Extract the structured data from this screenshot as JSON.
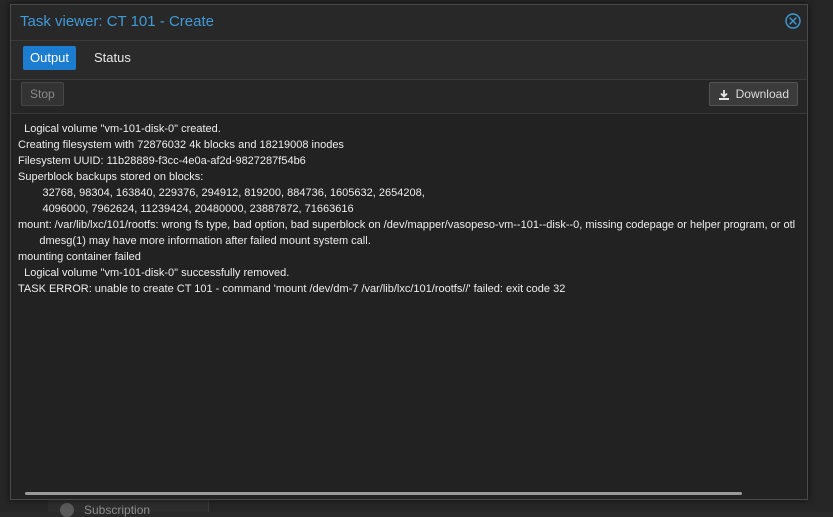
{
  "window": {
    "title": "Task viewer: CT 101 - Create",
    "close_icon": "close-circle-icon"
  },
  "tabs": [
    {
      "label": "Output",
      "active": true
    },
    {
      "label": "Status",
      "active": false
    }
  ],
  "toolbar": {
    "stop_label": "Stop",
    "download_label": "Download",
    "download_icon": "download-icon"
  },
  "log_lines": [
    "  Logical volume \"vm-101-disk-0\" created.",
    "Creating filesystem with 72876032 4k blocks and 18219008 inodes",
    "Filesystem UUID: 11b28889-f3cc-4e0a-af2d-9827287f54b6",
    "Superblock backups stored on blocks:",
    "        32768, 98304, 163840, 229376, 294912, 819200, 884736, 1605632, 2654208,",
    "        4096000, 7962624, 11239424, 20480000, 23887872, 71663616",
    "mount: /var/lib/lxc/101/rootfs: wrong fs type, bad option, bad superblock on /dev/mapper/vasopeso-vm--101--disk--0, missing codepage or helper program, or otl",
    "       dmesg(1) may have more information after failed mount system call.",
    "mounting container failed",
    "  Logical volume \"vm-101-disk-0\" successfully removed.",
    "TASK ERROR: unable to create CT 101 - command 'mount /dev/dm-7 /var/lib/lxc/101/rootfs//' failed: exit code 32"
  ],
  "background": {
    "sidebar_item_label": "Subscription"
  },
  "colors": {
    "title": "#3e9bd8",
    "active_tab": "#1b7cd0"
  }
}
